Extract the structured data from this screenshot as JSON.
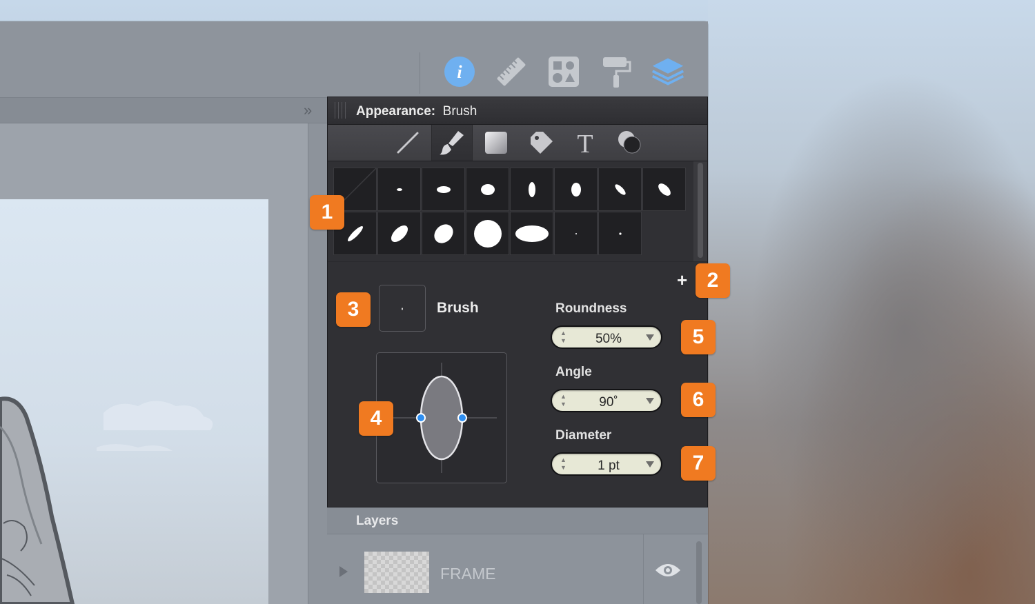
{
  "toolbar": {
    "icons": [
      "info-icon",
      "ruler-icon",
      "shapes-icon",
      "paint-roller-icon",
      "layers-icon"
    ],
    "active_color": "#6fb0f0"
  },
  "panel": {
    "title_label": "Appearance:",
    "title_value": "Brush",
    "tabs": [
      "stroke-tab",
      "brush-tab",
      "fill-tab",
      "tag-tab",
      "text-tab",
      "effects-tab"
    ],
    "active_tab": "brush-tab"
  },
  "brush": {
    "name": "Brush",
    "roundness_label": "Roundness",
    "roundness_value": "50%",
    "angle_label": "Angle",
    "angle_value": "90˚",
    "diameter_label": "Diameter",
    "diameter_value": "1 pt",
    "add_symbol": "+"
  },
  "callouts": [
    "1",
    "2",
    "3",
    "4",
    "5",
    "6",
    "7"
  ],
  "layers": {
    "title": "Layers",
    "items": [
      {
        "name": "FRAME"
      }
    ]
  },
  "colors": {
    "callout": "#f07a21",
    "panel_bg": "#303034",
    "handle_blue": "#2e8ef0"
  }
}
